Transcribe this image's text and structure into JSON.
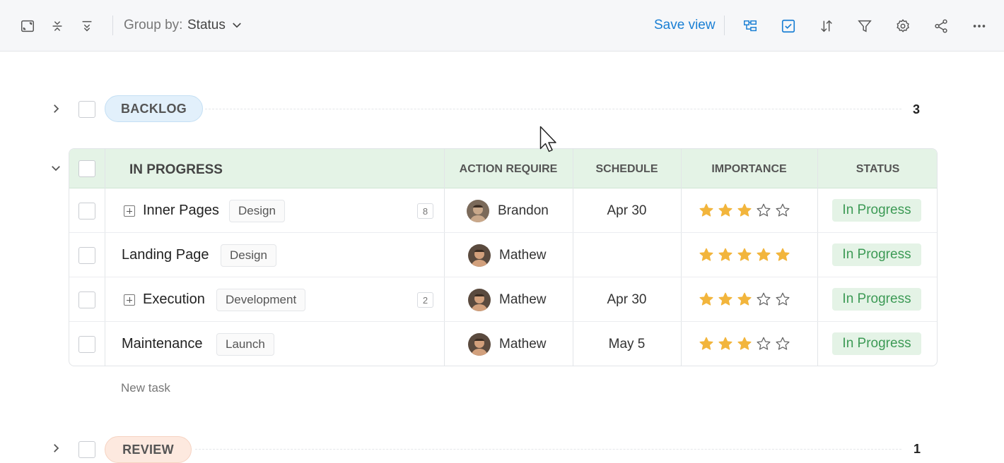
{
  "toolbar": {
    "icons": [
      "expand-icon",
      "collapse-rows-icon",
      "collapse-all-icon"
    ],
    "group_by_label": "Group by:",
    "group_by_value": "Status",
    "save_view_label": "Save view",
    "right_icons": [
      "hierarchy-icon",
      "checklist-icon",
      "sort-icon",
      "filter-icon",
      "settings-icon",
      "share-icon",
      "more-icon"
    ]
  },
  "groups": {
    "backlog": {
      "label": "BACKLOG",
      "count": "3",
      "color": "#e2f0fb"
    },
    "in_progress": {
      "label": "IN PROGRESS",
      "color": "#e4f3e6"
    },
    "review": {
      "label": "REVIEW",
      "count": "1",
      "color": "#fde9df"
    }
  },
  "table": {
    "columns": [
      "IN PROGRESS",
      "ACTION REQUIRE",
      "SCHEDULE",
      "IMPORTANCE",
      "STATUS"
    ],
    "rows": [
      {
        "name": "Inner Pages",
        "tag": "Design",
        "subtasks": "8",
        "has_subtasks": true,
        "assignee": "Brandon",
        "schedule": "Apr 30",
        "importance": 3,
        "status": "In Progress"
      },
      {
        "name": "Landing Page",
        "tag": "Design",
        "subtasks": "",
        "has_subtasks": false,
        "assignee": "Mathew",
        "schedule": "",
        "importance": 5,
        "status": "In Progress"
      },
      {
        "name": "Execution",
        "tag": "Development",
        "subtasks": "2",
        "has_subtasks": true,
        "assignee": "Mathew",
        "schedule": "Apr 30",
        "importance": 3,
        "status": "In Progress"
      },
      {
        "name": "Maintenance",
        "tag": "Launch",
        "subtasks": "",
        "has_subtasks": false,
        "assignee": "Mathew",
        "schedule": "May 5",
        "importance": 3,
        "status": "In Progress"
      }
    ],
    "new_task_label": "New task"
  },
  "colors": {
    "accent": "#1a7fd4",
    "star": "#f2b53c",
    "status_text": "#3c9a55"
  }
}
